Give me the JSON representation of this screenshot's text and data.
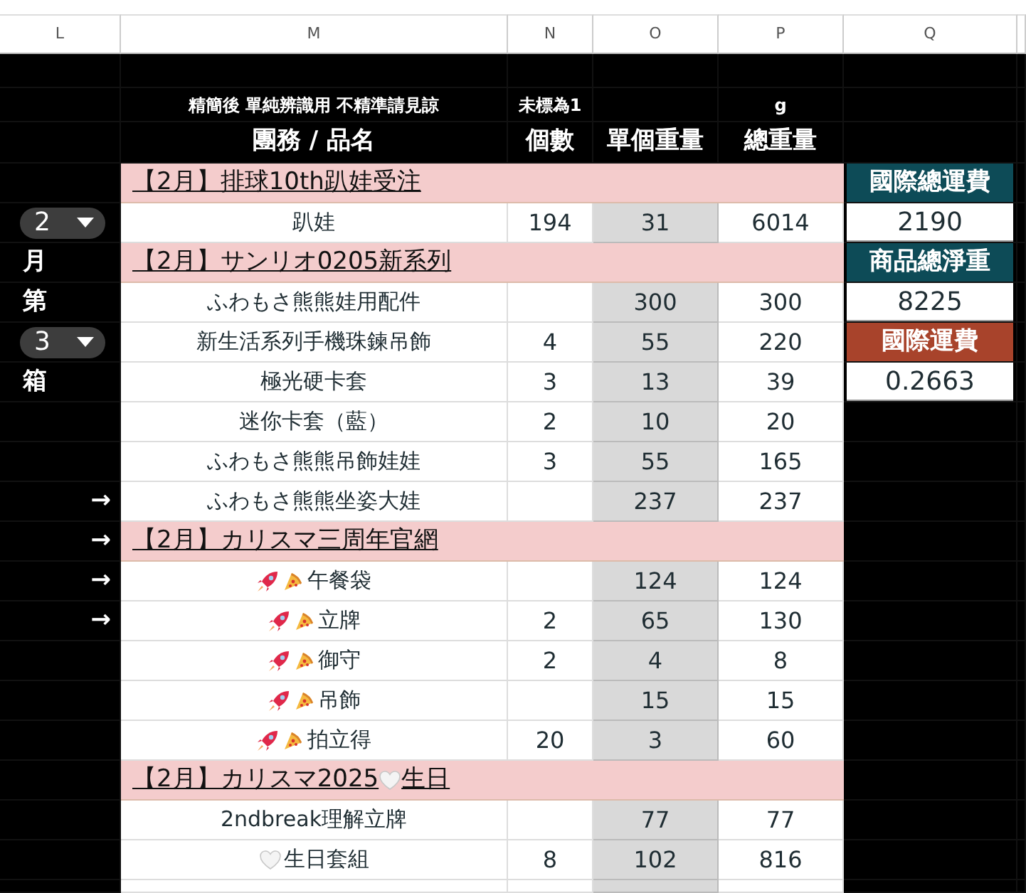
{
  "column_headers": [
    "L",
    "M",
    "N",
    "O",
    "P",
    "Q"
  ],
  "notes": {
    "name": "精簡後 單純辨識用 不精準請見諒",
    "count": "未標為1",
    "total_weight": "g"
  },
  "headings": {
    "name": "團務 / 品名",
    "count": "個數",
    "unit_weight": "單個重量",
    "total_weight": "總重量"
  },
  "rows": [
    {
      "kind": "group",
      "parts": [
        {
          "kind": "text",
          "text": "【2月】排球10th趴娃受注"
        }
      ],
      "summary": {
        "kind": "header",
        "text": "國際總運費",
        "color": "#0d4b57"
      }
    },
    {
      "kind": "item",
      "side": {
        "kind": "dropdown",
        "text": "2"
      },
      "parts": [
        {
          "kind": "text",
          "text": "趴娃"
        }
      ],
      "count": "194",
      "unit_weight": "31",
      "total_weight": "6014",
      "summary": {
        "kind": "value",
        "text": "2190"
      }
    },
    {
      "kind": "group",
      "side": {
        "kind": "label",
        "text": "月"
      },
      "parts": [
        {
          "kind": "text",
          "text": "【2月】サンリオ0205新系列"
        }
      ],
      "summary": {
        "kind": "header",
        "text": "商品總淨重",
        "color": "#0d4b57"
      }
    },
    {
      "kind": "item",
      "side": {
        "kind": "label",
        "text": "第"
      },
      "parts": [
        {
          "kind": "text",
          "text": "ふわもさ熊熊娃用配件"
        }
      ],
      "unit_weight": "300",
      "total_weight": "300",
      "summary": {
        "kind": "value",
        "text": "8225"
      }
    },
    {
      "kind": "item",
      "side": {
        "kind": "dropdown",
        "text": "3"
      },
      "parts": [
        {
          "kind": "text",
          "text": "新生活系列手機珠鍊吊飾"
        }
      ],
      "count": "4",
      "unit_weight": "55",
      "total_weight": "220",
      "summary": {
        "kind": "header",
        "text": "國際運費",
        "color": "#a8432b"
      }
    },
    {
      "kind": "item",
      "side": {
        "kind": "label",
        "text": "箱"
      },
      "parts": [
        {
          "kind": "text",
          "text": "極光硬卡套"
        }
      ],
      "count": "3",
      "unit_weight": "13",
      "total_weight": "39",
      "summary": {
        "kind": "value",
        "text": "0.2663"
      }
    },
    {
      "kind": "item",
      "parts": [
        {
          "kind": "text",
          "text": "迷你卡套（藍）"
        }
      ],
      "count": "2",
      "unit_weight": "10",
      "total_weight": "20"
    },
    {
      "kind": "item",
      "parts": [
        {
          "kind": "text",
          "text": "ふわもさ熊熊吊飾娃娃"
        }
      ],
      "count": "3",
      "unit_weight": "55",
      "total_weight": "165"
    },
    {
      "kind": "item",
      "side": {
        "kind": "arrow",
        "text": "→"
      },
      "parts": [
        {
          "kind": "text",
          "text": "ふわもさ熊熊坐姿大娃"
        }
      ],
      "unit_weight": "237",
      "total_weight": "237"
    },
    {
      "kind": "group",
      "side": {
        "kind": "arrow",
        "text": "→"
      },
      "parts": [
        {
          "kind": "text",
          "text": "【2月】カリスマ三周年官網"
        }
      ]
    },
    {
      "kind": "item",
      "side": {
        "kind": "arrow",
        "text": "→"
      },
      "parts": [
        {
          "kind": "rocket"
        },
        {
          "kind": "pizza"
        },
        {
          "kind": "text",
          "text": "午餐袋"
        }
      ],
      "unit_weight": "124",
      "total_weight": "124"
    },
    {
      "kind": "item",
      "side": {
        "kind": "arrow",
        "text": "→"
      },
      "parts": [
        {
          "kind": "rocket"
        },
        {
          "kind": "pizza"
        },
        {
          "kind": "text",
          "text": "立牌"
        }
      ],
      "count": "2",
      "unit_weight": "65",
      "total_weight": "130"
    },
    {
      "kind": "item",
      "parts": [
        {
          "kind": "rocket"
        },
        {
          "kind": "pizza"
        },
        {
          "kind": "text",
          "text": "御守"
        }
      ],
      "count": "2",
      "unit_weight": "4",
      "total_weight": "8"
    },
    {
      "kind": "item",
      "parts": [
        {
          "kind": "rocket"
        },
        {
          "kind": "pizza"
        },
        {
          "kind": "text",
          "text": "吊飾"
        }
      ],
      "unit_weight": "15",
      "total_weight": "15"
    },
    {
      "kind": "item",
      "parts": [
        {
          "kind": "rocket"
        },
        {
          "kind": "pizza"
        },
        {
          "kind": "text",
          "text": "拍立得"
        }
      ],
      "count": "20",
      "unit_weight": "3",
      "total_weight": "60"
    },
    {
      "kind": "group",
      "parts": [
        {
          "kind": "text",
          "text": "【2月】カリスマ2025"
        },
        {
          "kind": "heart"
        },
        {
          "kind": "text",
          "text": "生日"
        }
      ]
    },
    {
      "kind": "item",
      "parts": [
        {
          "kind": "text",
          "text": "2ndbreak理解立牌"
        }
      ],
      "unit_weight": "77",
      "total_weight": "77"
    },
    {
      "kind": "item",
      "parts": [
        {
          "kind": "heart"
        },
        {
          "kind": "text",
          "text": "生日套組"
        }
      ],
      "count": "8",
      "unit_weight": "102",
      "total_weight": "816"
    }
  ]
}
